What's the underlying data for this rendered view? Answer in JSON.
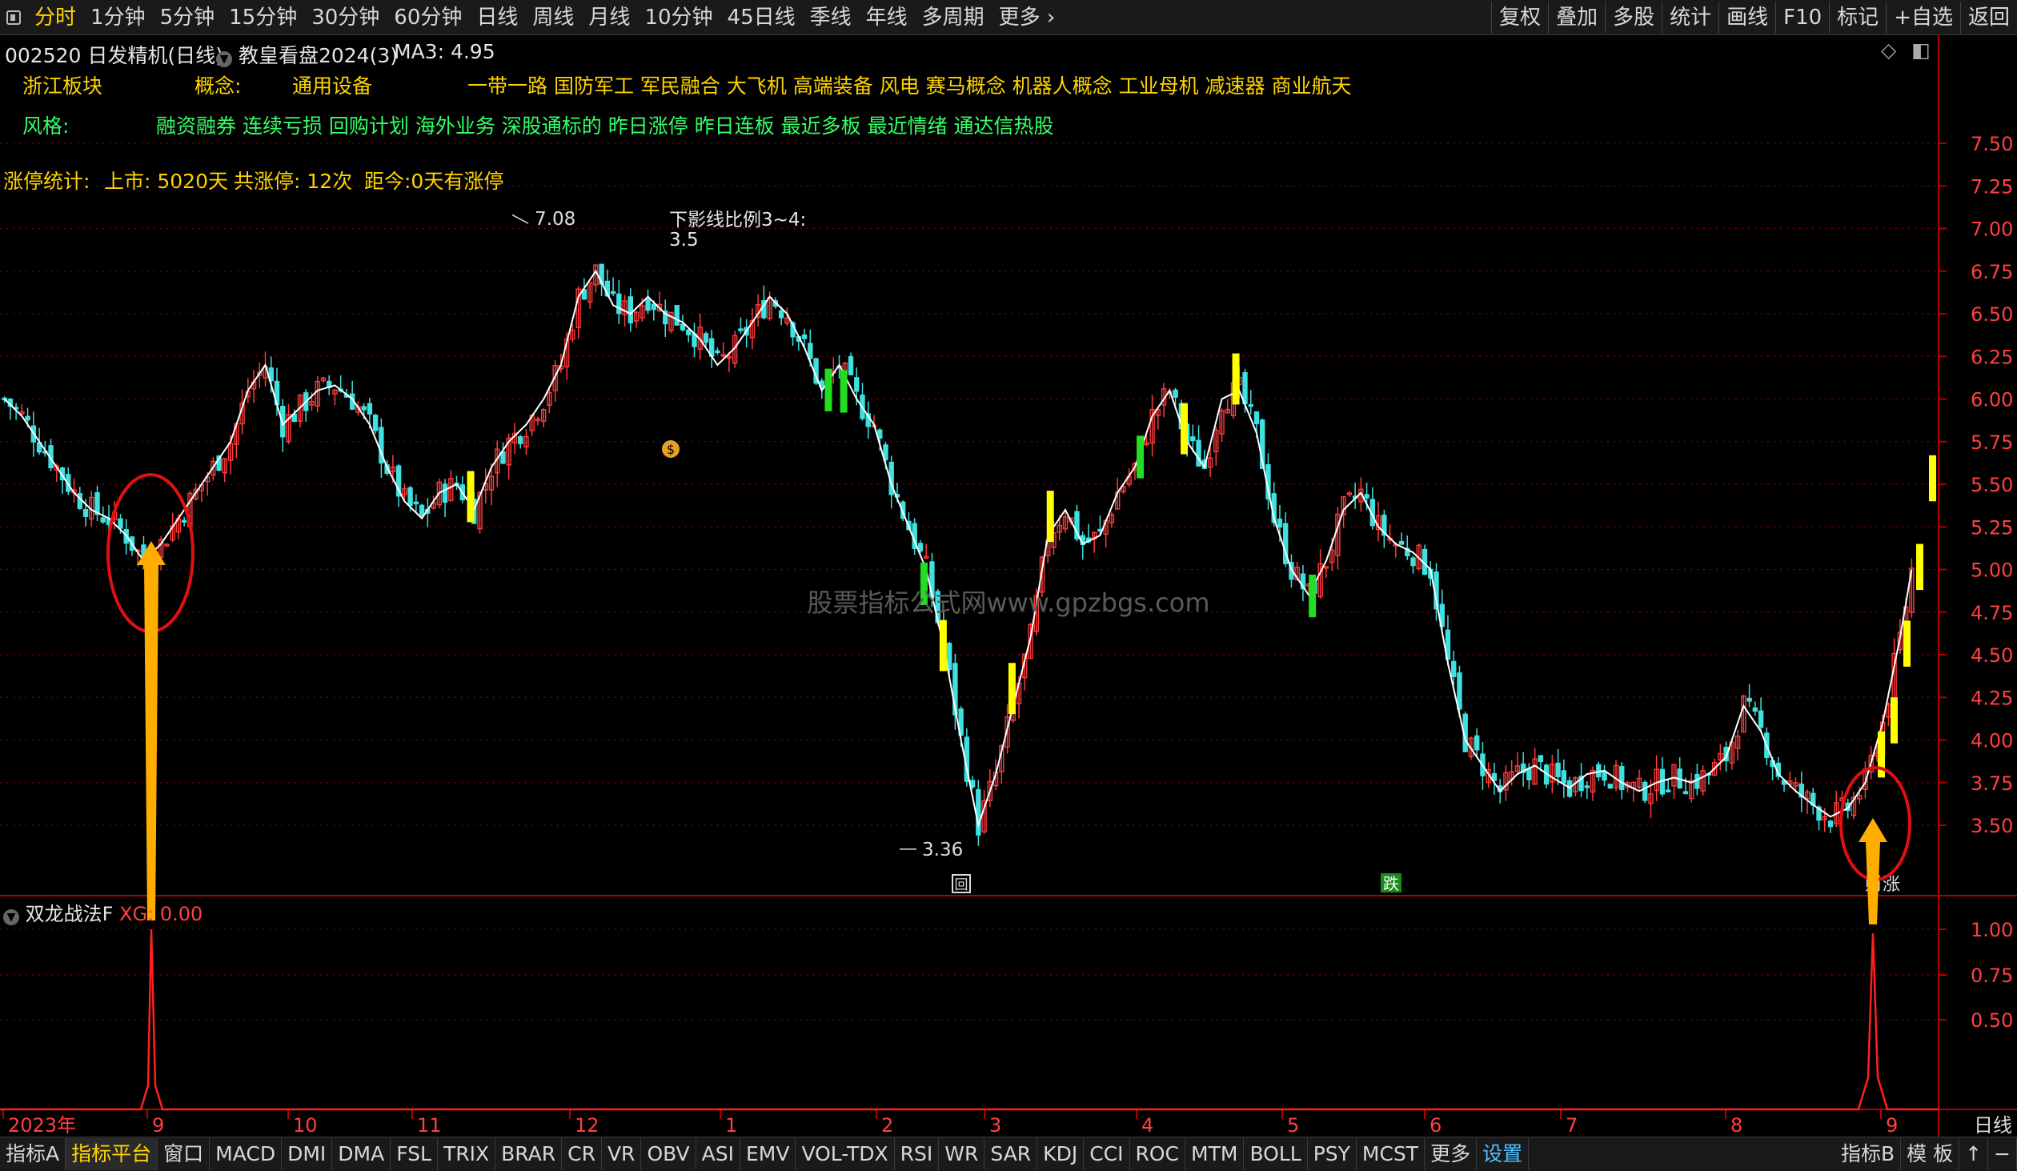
{
  "toolbar": {
    "periods": [
      "分时",
      "1分钟",
      "5分钟",
      "15分钟",
      "30分钟",
      "60分钟",
      "日线",
      "周线",
      "月线",
      "10分钟",
      "45日线",
      "季线",
      "年线",
      "多周期",
      "更多"
    ],
    "active_index": 0,
    "right_buttons": [
      "复权",
      "叠加",
      "多股",
      "统计",
      "画线",
      "F10",
      "标记",
      "+自选",
      "返回"
    ]
  },
  "stock_header": {
    "code_name": "002520 日发精机(日线)",
    "indicator": "教皇看盘2024(3)",
    "ma": "MA3: 4.95"
  },
  "info_rows": {
    "sector_label": "浙江板块",
    "concept_label": "概念:",
    "industry": "通用设备",
    "concepts": "一带一路 国防军工 军民融合 大飞机 高端装备 风电 赛马概念 机器人概念 工业母机 减速器 商业航天",
    "style_label": "风格:",
    "styles": "融资融券 连续亏损 回购计划 海外业务 深股通标的 昨日涨停 昨日连板 最近多板 最近情绪 通达信热股",
    "limit_stats_label": "涨停统计:",
    "listed": "上市: 5020天",
    "limit_count": "共涨停: 12次",
    "since": "距今:0天有涨停"
  },
  "annotations": {
    "high": "7.08",
    "low": "3.36",
    "shadow_label": "下影线比例3~4:",
    "shadow_value": "3.5",
    "watermark": "股票指标公式网www.gpzbgs.com",
    "marker_die": "跌",
    "marker_hui": "回",
    "marker_right": "财涨"
  },
  "indicator_panel": {
    "name": "双龙战法F",
    "xg_label": "XG: 0.00",
    "y_ticks": [
      "1.00",
      "0.75",
      "0.50"
    ]
  },
  "bottom_tabs": [
    "指标A",
    "指标平台",
    "窗口",
    "MACD",
    "DMI",
    "DMA",
    "FSL",
    "TRIX",
    "BRAR",
    "CR",
    "VR",
    "OBV",
    "ASI",
    "EMV",
    "VOL-TDX",
    "RSI",
    "WR",
    "SAR",
    "KDJ",
    "CCI",
    "ROC",
    "MTM",
    "BOLL",
    "PSY",
    "MCST",
    "更多",
    "设置"
  ],
  "bottom_right": [
    "指标B",
    "模 板",
    "↑",
    "−"
  ],
  "period_label": "日线",
  "colors": {
    "up": "#ff3b3b",
    "down": "#3fe0e0",
    "ma": "#ffffff",
    "limit_up": "#ffff00",
    "limit_down": "#22dd22",
    "signal": "#ff2020",
    "arrow": "#ffae00"
  },
  "chart_data": [
    {
      "type": "candlestick",
      "title": "002520 日发精机(日线)",
      "x_axis_labels": [
        "2023年",
        "9",
        "10",
        "11",
        "12",
        "1",
        "2",
        "3",
        "4",
        "5",
        "6",
        "7",
        "8",
        "9"
      ],
      "y_ticks": [
        "7.50",
        "7.25",
        "7.00",
        "6.75",
        "6.50",
        "6.25",
        "6.00",
        "5.75",
        "5.50",
        "5.25",
        "5.00",
        "4.75",
        "4.50",
        "4.25",
        "4.00",
        "3.75",
        "3.50"
      ],
      "ylim": [
        3.28,
        7.55
      ],
      "close_path": [
        6.0,
        5.9,
        5.75,
        5.6,
        5.45,
        5.35,
        5.3,
        5.2,
        5.05,
        5.15,
        5.3,
        5.45,
        5.6,
        5.75,
        6.05,
        6.2,
        5.85,
        5.95,
        6.05,
        6.08,
        6.0,
        5.85,
        5.6,
        5.4,
        5.3,
        5.45,
        5.5,
        5.35,
        5.6,
        5.75,
        5.85,
        6.0,
        6.2,
        6.6,
        6.75,
        6.55,
        6.5,
        6.6,
        6.5,
        6.45,
        6.35,
        6.2,
        6.3,
        6.45,
        6.6,
        6.5,
        6.3,
        6.05,
        6.2,
        6.0,
        5.85,
        5.5,
        5.25,
        5.0,
        4.55,
        4.0,
        3.5,
        3.8,
        4.2,
        4.6,
        5.2,
        5.35,
        5.15,
        5.2,
        5.45,
        5.6,
        5.9,
        6.05,
        5.75,
        5.6,
        6.0,
        6.05,
        5.8,
        5.3,
        5.0,
        4.85,
        5.05,
        5.35,
        5.45,
        5.25,
        5.15,
        5.1,
        5.0,
        4.45,
        4.0,
        3.85,
        3.7,
        3.8,
        3.85,
        3.78,
        3.72,
        3.8,
        3.82,
        3.75,
        3.7,
        3.75,
        3.78,
        3.75,
        3.8,
        3.9,
        4.2,
        4.05,
        3.8,
        3.7,
        3.62,
        3.55,
        3.6,
        3.75,
        4.1,
        4.6,
        5.2
      ],
      "limit_up_days": [
        0.245,
        0.492,
        0.528,
        0.548,
        0.618,
        0.645
      ],
      "limit_down_days": [
        0.432,
        0.44,
        0.482,
        0.595,
        0.685
      ],
      "final_rally_values": [
        3.8,
        4.0,
        4.45,
        4.9,
        5.42
      ]
    },
    {
      "type": "line",
      "title": "双龙战法F",
      "series": [
        {
          "name": "XG",
          "values": [
            0,
            1,
            0,
            1,
            0
          ]
        }
      ],
      "ylim": [
        0,
        1.15
      ],
      "signal_positions": [
        "9 (2023)",
        "9 (2024)"
      ]
    }
  ]
}
